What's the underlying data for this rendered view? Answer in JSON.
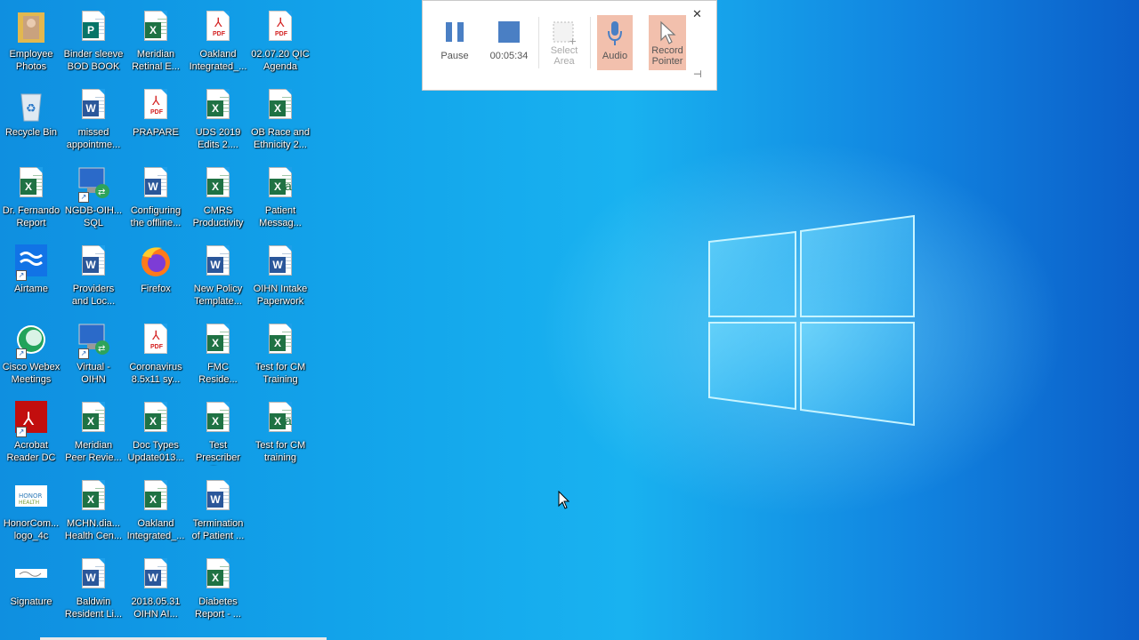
{
  "recorder": {
    "pause_label": "Pause",
    "elapsed": "00:05:34",
    "select_area_label": "Select\nArea",
    "audio_label": "Audio",
    "record_pointer_label": "Record\nPointer",
    "close_glyph": "✕",
    "pin_glyph": "⊣"
  },
  "desktop_icons": [
    {
      "label": "Employee\nPhotos",
      "kind": "folder"
    },
    {
      "label": "Recycle Bin",
      "kind": "recycle"
    },
    {
      "label": "Dr. Fernando\nReport",
      "kind": "excel"
    },
    {
      "label": "Airtame",
      "kind": "airtame"
    },
    {
      "label": "Cisco Webex\nMeetings",
      "kind": "webex"
    },
    {
      "label": "Acrobat\nReader DC",
      "kind": "acrobat"
    },
    {
      "label": "HonorCom...\nlogo_4c",
      "kind": "image"
    },
    {
      "label": "Signature",
      "kind": "signature"
    },
    {
      "label": "Binder sleeve\nBOD BOOK",
      "kind": "publisher"
    },
    {
      "label": "missed\nappointme...",
      "kind": "word"
    },
    {
      "label": "NGDB-OIH...\nSQL",
      "kind": "rdp"
    },
    {
      "label": "Providers\nand Loc...",
      "kind": "word"
    },
    {
      "label": "Virtual -\nOIHN",
      "kind": "rdp"
    },
    {
      "label": "Meridian\nPeer Revie...",
      "kind": "excel"
    },
    {
      "label": "MCHN.dia...\nHealth Cen...",
      "kind": "excel"
    },
    {
      "label": "Baldwin\nResident Li...",
      "kind": "word"
    },
    {
      "label": "Meridian\nRetinal E...",
      "kind": "excel"
    },
    {
      "label": "PRAPARE",
      "kind": "pdf"
    },
    {
      "label": "Configuring\nthe offline...",
      "kind": "word"
    },
    {
      "label": "Firefox",
      "kind": "firefox"
    },
    {
      "label": "Coronavirus\n8.5x11 sy...",
      "kind": "pdf"
    },
    {
      "label": "Doc Types\nUpdate013...",
      "kind": "excel"
    },
    {
      "label": "Oakland\nIntegrated_...",
      "kind": "excel"
    },
    {
      "label": "2018.05.31\nOIHN AI...",
      "kind": "word"
    },
    {
      "label": "Oakland\nIntegrated_...",
      "kind": "pdf"
    },
    {
      "label": "UDS 2019\nEdits 2....",
      "kind": "excel"
    },
    {
      "label": "CMRS\nProductivity",
      "kind": "excel"
    },
    {
      "label": "New Policy\nTemplate...",
      "kind": "word"
    },
    {
      "label": "FMC\nReside...",
      "kind": "excel"
    },
    {
      "label": "Test\nPrescriber R...",
      "kind": "excel"
    },
    {
      "label": "Termination\nof Patient ...",
      "kind": "word"
    },
    {
      "label": "Diabetes\nReport - ...",
      "kind": "excel"
    },
    {
      "label": "02.07.20 QIC\nAgenda",
      "kind": "pdf"
    },
    {
      "label": "OB Race and\nEthnicity 2...",
      "kind": "excel"
    },
    {
      "label": "Patient\nMessag...",
      "kind": "excelcsv"
    },
    {
      "label": "OIHN Intake\nPaperwork",
      "kind": "word"
    },
    {
      "label": "Test for CM\nTraining",
      "kind": "excel"
    },
    {
      "label": "Test for CM\ntraining",
      "kind": "excelcsv"
    }
  ]
}
